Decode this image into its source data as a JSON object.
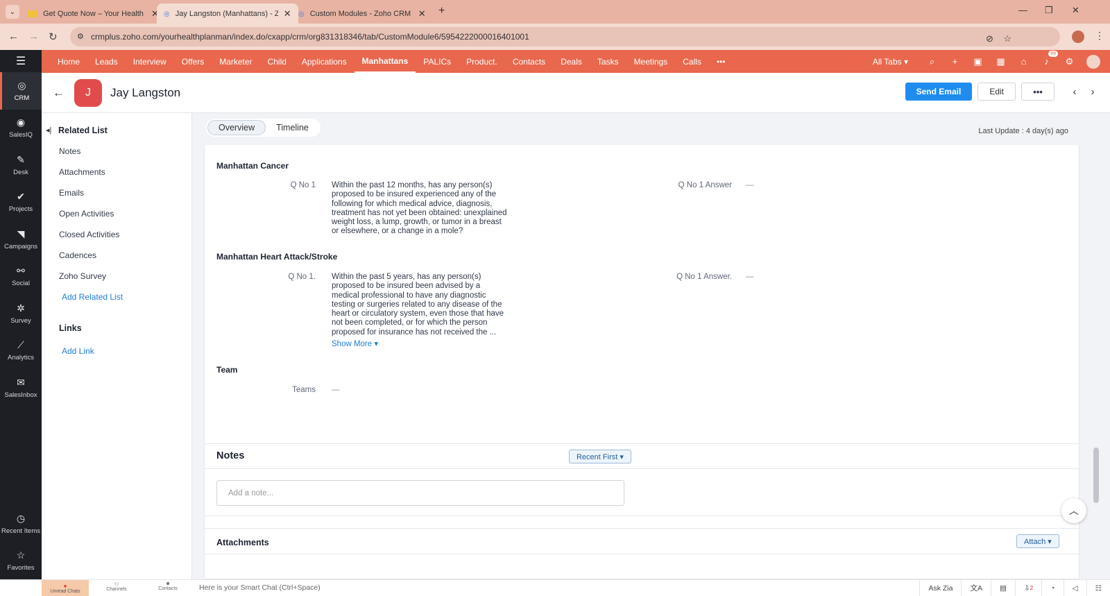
{
  "browser": {
    "tabs": [
      {
        "title": "Get Quote Now – Your Health P",
        "active": false
      },
      {
        "title": "Jay Langston (Manhattans) - Zo",
        "active": true
      },
      {
        "title": "Custom Modules - Zoho CRM",
        "active": false
      }
    ],
    "new_tab": "+",
    "url": "crmplus.zoho.com/yourhealthplanman/index.do/cxapp/crm/org831318346/tab/CustomModule6/5954222000016401001"
  },
  "rail": {
    "items": [
      {
        "label": "CRM",
        "icon": "crm-icon"
      },
      {
        "label": "SalesIQ",
        "icon": "salesiq-icon"
      },
      {
        "label": "Desk",
        "icon": "desk-icon"
      },
      {
        "label": "Projects",
        "icon": "projects-icon"
      },
      {
        "label": "Campaigns",
        "icon": "campaigns-icon"
      },
      {
        "label": "Social",
        "icon": "social-icon"
      },
      {
        "label": "Survey",
        "icon": "survey-icon"
      },
      {
        "label": "Analytics",
        "icon": "analytics-icon"
      },
      {
        "label": "SalesInbox",
        "icon": "salesinbox-icon"
      }
    ],
    "recent": "Recent Items",
    "favorites": "Favorites"
  },
  "topnav": {
    "items": [
      "Home",
      "Leads",
      "Interview",
      "Offers",
      "Marketer",
      "Child",
      "Applications",
      "Manhattans",
      "PALICs",
      "Product.",
      "Contacts",
      "Deals",
      "Tasks",
      "Meetings",
      "Calls"
    ],
    "active": "Manhattans",
    "more": "•••",
    "all_tabs": "All Tabs",
    "notification_count": "99"
  },
  "record": {
    "avatar_letter": "J",
    "name": "Jay Langston",
    "send_email": "Send Email",
    "edit": "Edit",
    "more": "•••"
  },
  "related": {
    "title": "Related List",
    "items": [
      "Notes",
      "Attachments",
      "Emails",
      "Open Activities",
      "Closed Activities",
      "Cadences",
      "Zoho Survey"
    ],
    "add_related": "Add Related List",
    "links_title": "Links",
    "add_link": "Add Link"
  },
  "view_tabs": {
    "overview": "Overview",
    "timeline": "Timeline",
    "last_update": "Last Update : 4 day(s) ago"
  },
  "sections": {
    "cancer": {
      "title": "Manhattan Cancer",
      "q_label": "Q No 1",
      "q_lines": [
        "Within the past 12 months, has any person(s)",
        "proposed to be insured experienced any of the",
        "following for which medical advice, diagnosis,",
        "treatment has not yet been obtained: unexplained",
        "weight loss, a lump, growth, or tumor in a breast",
        "or elsewhere, or a change in a mole?"
      ],
      "a_label": "Q No 1 Answer",
      "a_value": "—"
    },
    "heart": {
      "title": "Manhattan Heart Attack/Stroke",
      "q_label": "Q No 1.",
      "q_lines": [
        "Within the past 5 years, has any person(s)",
        "proposed to be insured been advised by a",
        "medical professional to have any diagnostic",
        "testing or surgeries related to any disease of the",
        "heart or circulatory system, even those that have",
        "not been completed, or for which the person",
        "proposed for insurance has not received the ..."
      ],
      "show_more": "Show More ▾",
      "a_label": "Q No 1 Answer.",
      "a_value": "—"
    },
    "team": {
      "title": "Team",
      "label": "Teams",
      "value": "—"
    }
  },
  "notes": {
    "title": "Notes",
    "sort": "Recent First ▾",
    "placeholder": "Add a note..."
  },
  "attachments": {
    "title": "Attachments",
    "attach": "Attach ▾"
  },
  "bottom": {
    "unread": "Unread Chats",
    "channels": "Channels",
    "contacts": "Contacts",
    "smart_chat": "Here is your Smart Chat (Ctrl+Space)",
    "ask_zia": "Ask Zia",
    "badge": "2"
  },
  "colors": {
    "brand": "#e8674d",
    "primary": "#1f8df0",
    "rail": "#1d1f24"
  }
}
